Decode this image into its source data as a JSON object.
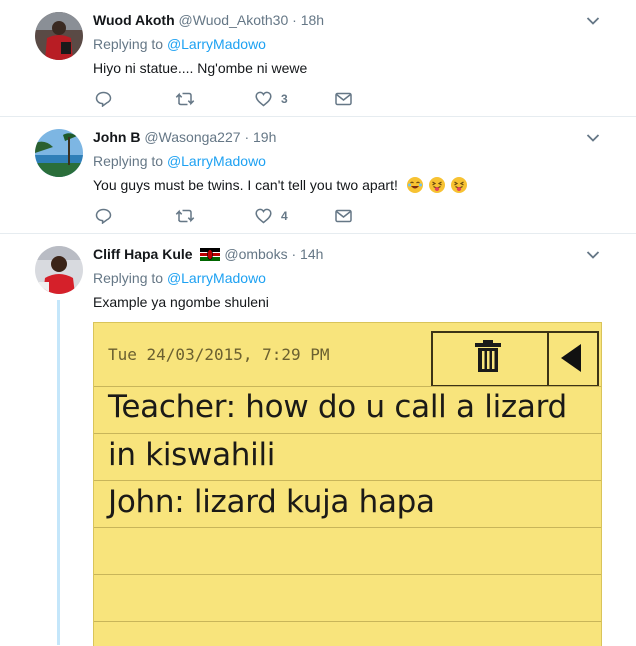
{
  "tweets": [
    {
      "name": "Wuod Akoth",
      "handle": "@Wuod_Akoth30",
      "dot": "·",
      "time": "18h",
      "replying_prefix": "Replying to",
      "replying_to": "@LarryMadowo",
      "text": "Hiyo ni statue.... Ng'ombe ni wewe",
      "likes": "3",
      "avatar_icon": "user-avatar-red-jersey"
    },
    {
      "name": "John B",
      "handle": "@Wasonga227",
      "dot": "·",
      "time": "19h",
      "replying_prefix": "Replying to",
      "replying_to": "@LarryMadowo",
      "text": "You guys must be twins. I can't tell you two apart!",
      "likes": "4",
      "avatar_icon": "user-avatar-beach"
    },
    {
      "name": "Cliff Hapa Kule",
      "handle": "@omboks",
      "dot": "·",
      "time": "14h",
      "replying_prefix": "Replying to",
      "replying_to": "@LarryMadowo",
      "text": "Example ya ngombe shuleni",
      "avatar_icon": "user-avatar-red-shirt",
      "flag_icon": "kenya-flag-icon"
    }
  ],
  "media": {
    "timestamp": "Tue 24/03/2015, 7:29 PM",
    "lines": [
      "Teacher: how do u call a lizard",
      "in kiswahili",
      "John: lizard kuja hapa"
    ],
    "background": "#f8e47c"
  },
  "colors": {
    "link": "#1da1f2",
    "muted": "#657786",
    "divider": "#e6ecf0",
    "thread": "#c4e6fa"
  }
}
